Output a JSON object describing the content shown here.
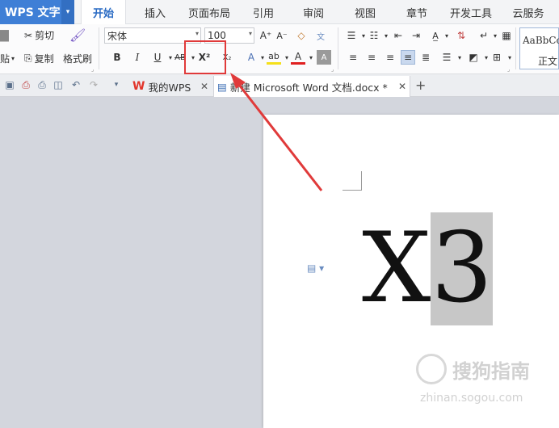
{
  "app": {
    "name": "WPS 文字",
    "dropdown": "▾"
  },
  "menu_tabs": [
    {
      "label": "开始",
      "active": true
    },
    {
      "label": "插入"
    },
    {
      "label": "页面布局"
    },
    {
      "label": "引用"
    },
    {
      "label": "审阅"
    },
    {
      "label": "视图"
    },
    {
      "label": "章节"
    },
    {
      "label": "开发工具"
    },
    {
      "label": "云服务"
    }
  ],
  "ribbon": {
    "cut": "剪切",
    "paste": "贴",
    "copy": "复制",
    "format_painter": "格式刷",
    "font_name": "宋体",
    "font_size": "100",
    "grow_font": "A⁺",
    "shrink_font": "A⁻",
    "bold": "B",
    "italic": "I",
    "underline": "U",
    "strikethrough": "AB",
    "superscript": "X²",
    "subscript": "X₂",
    "text_effect": "A",
    "highlight": "ab",
    "font_color": "A",
    "char_shading": "A",
    "style_preview": "AaBbCc",
    "style_name": "正文"
  },
  "tabstrip": {
    "tabs": [
      {
        "label": "我的WPS",
        "icon": "W"
      },
      {
        "label": "新建 Microsoft Word 文档.docx *",
        "active": true
      }
    ],
    "plus": "+"
  },
  "document": {
    "text_main": "X",
    "text_selected": "3"
  },
  "watermark": {
    "brand": "搜狗指南",
    "url": "zhinan.sogou.com"
  },
  "colors": {
    "app_blue": "#3f7fd6",
    "active_tab_text": "#2b6cc4",
    "highlight_red": "#e03a3a",
    "selection": "#c7c7c7"
  }
}
